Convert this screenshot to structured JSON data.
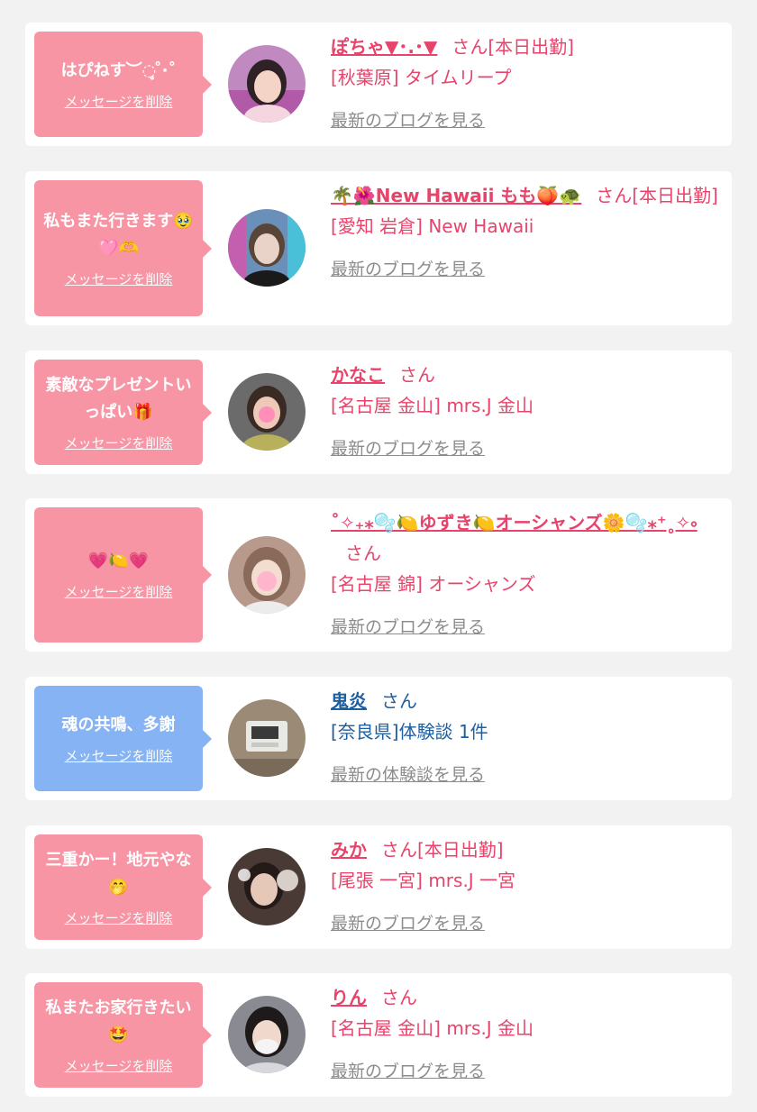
{
  "delete_label": "メッセージを削除",
  "san_label": "さん",
  "colors": {
    "bubble_pink": "#f795a5",
    "bubble_blue": "#86b3f4",
    "name_pink": "#e8436a",
    "name_blue": "#1f5fa0",
    "link_gray": "#8c8c8c"
  },
  "items": [
    {
      "message": "はぴねす︶◌̥̥̥̥̥̥ ̊·˚",
      "name": "ぽちゃ▼･.･▼",
      "status": "[本日出勤]",
      "shop": "[秋葉原] タイムリープ",
      "link": "最新のブログを見る",
      "avatar": "girl-photo-1",
      "type": "pink"
    },
    {
      "message": "私もまた行きます🥹🩷🫶",
      "name": "🌴🌺New Hawaii もも🍑🐢",
      "status": "[本日出勤]",
      "shop": "[愛知 岩倉] New Hawaii",
      "link": "最新のブログを見る",
      "avatar": "girl-photo-2",
      "type": "pink"
    },
    {
      "message": "素敵なプレゼントいっぱい🎁",
      "name": "かなこ",
      "status": "",
      "shop": "[名古屋 金山] mrs.J 金山",
      "link": "最新のブログを見る",
      "avatar": "girl-photo-3",
      "type": "pink"
    },
    {
      "message": "💗🍋💗",
      "name": "˚✧₊⁎🫧🍋ゆずき🍋オーシャンズ🌼🫧⁎⁺˳✧༚",
      "status": "",
      "shop": "[名古屋 錦] オーシャンズ",
      "link": "最新のブログを見る",
      "avatar": "girl-photo-4",
      "type": "pink"
    },
    {
      "message": "魂の共鳴、多謝",
      "name": "鬼炎",
      "status": "",
      "shop": "[奈良県]体験談 1件",
      "link": "最新の体験談を見る",
      "avatar": "clock-photo",
      "type": "blue"
    },
    {
      "message": "三重かー！地元やな🤭",
      "name": "みか",
      "status": "[本日出勤]",
      "shop": "[尾張 一宮] mrs.J 一宮",
      "link": "最新のブログを見る",
      "avatar": "girl-photo-5",
      "type": "pink"
    },
    {
      "message": "私またお家行きたい🤩",
      "name": "りん",
      "status": "",
      "shop": "[名古屋 金山] mrs.J 金山",
      "link": "最新のブログを見る",
      "avatar": "girl-photo-6",
      "type": "pink"
    }
  ]
}
